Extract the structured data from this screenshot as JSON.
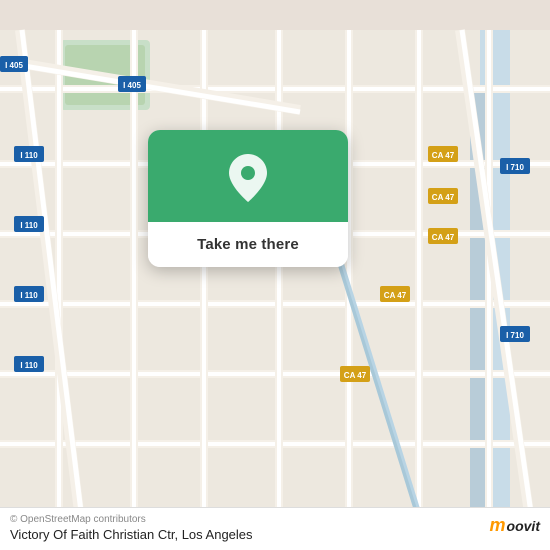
{
  "map": {
    "bg_color": "#e8e0d8",
    "alt": "Street map of Los Angeles area"
  },
  "card": {
    "button_label": "Take me there",
    "green_color": "#3aaa6e"
  },
  "bottom": {
    "copyright": "© OpenStreetMap contributors",
    "location_name": "Victory Of Faith Christian Ctr, Los Angeles"
  },
  "moovit": {
    "logo_text": "moovit"
  },
  "highway_labels": [
    "I 405",
    "I 110",
    "CA 47",
    "I 710"
  ],
  "icons": {
    "pin": "location-pin-icon"
  }
}
